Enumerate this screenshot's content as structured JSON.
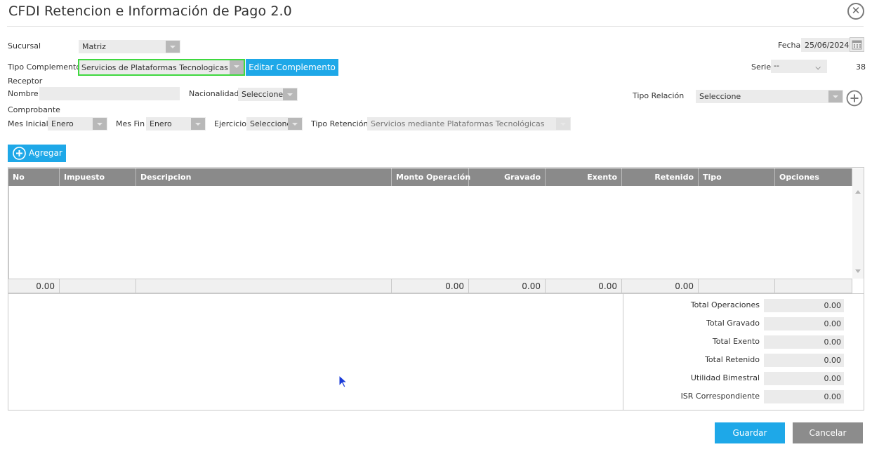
{
  "dialog": {
    "title": "CFDI Retencion e Información de Pago 2.0",
    "close_icon": "close-circle-icon"
  },
  "form": {
    "sucursal": {
      "label": "Sucursal",
      "value": "Matriz"
    },
    "fecha": {
      "label": "Fecha",
      "value": "25/06/2024",
      "icon": "calendar-icon"
    },
    "tipo_complemento": {
      "label": "Tipo Complemento",
      "value": "Servicios de Plataformas Tecnologicas"
    },
    "editar_button": "Editar Complemento",
    "serie": {
      "label": "Serie",
      "value": "--",
      "folio": "38"
    },
    "receptor_heading": "Receptor",
    "nombre": {
      "label": "Nombre",
      "value": ""
    },
    "nacionalidad": {
      "label": "Nacionalidad",
      "value": "Seleccione"
    },
    "tipo_relacion": {
      "label": "Tipo Relación",
      "value": "Seleccione",
      "add_icon": "plus-circle-icon"
    },
    "comprobante_heading": "Comprobante",
    "mes_inicial": {
      "label": "Mes Inicial",
      "value": "Enero"
    },
    "mes_fin": {
      "label": "Mes Fin",
      "value": "Enero"
    },
    "ejercicio": {
      "label": "Ejercicio",
      "value": "Seleccione"
    },
    "tipo_retencion": {
      "label": "Tipo Retención",
      "value": "Servicios mediante Plataformas Tecnológicas"
    }
  },
  "agregar_button": "Agregar",
  "grid": {
    "columns": [
      "No",
      "Impuesto",
      "Descripcion",
      "Monto Operación",
      "Gravado",
      "Exento",
      "Retenido",
      "Tipo",
      "Opciones"
    ],
    "footer": [
      "0.00",
      "",
      "",
      "0.00",
      "0.00",
      "0.00",
      "0.00",
      "",
      ""
    ]
  },
  "totals": [
    {
      "label": "Total Operaciones",
      "value": "0.00"
    },
    {
      "label": "Total Gravado",
      "value": "0.00"
    },
    {
      "label": "Total Exento",
      "value": "0.00"
    },
    {
      "label": "Total Retenido",
      "value": "0.00"
    },
    {
      "label": "Utilidad Bimestral",
      "value": "0.00"
    },
    {
      "label": "ISR Correspondiente",
      "value": "0.00"
    }
  ],
  "actions": {
    "guardar": "Guardar",
    "cancelar": "Cancelar"
  },
  "colors": {
    "accent": "#1ea8e8",
    "focus_border": "#3fd83f",
    "header_gray": "#8a8a8a"
  }
}
